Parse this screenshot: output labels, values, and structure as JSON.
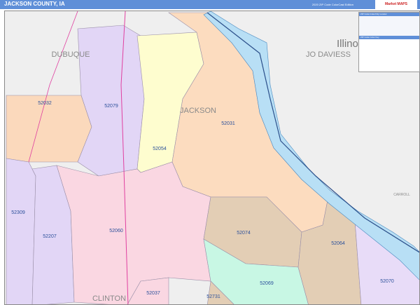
{
  "header": {
    "title": "JACKSON COUNTY, IA",
    "edition": "2020 ZIP Code ColorCast Edition",
    "logo": "Market MAPS"
  },
  "map": {
    "county_labels": [
      "DUBUQUE",
      "JACKSON",
      "CLINTON",
      "JO DAVIESS",
      "CARROLL"
    ],
    "state_label": "Illinois",
    "zips": [
      {
        "zip": "52032",
        "color": "#fbd9bc"
      },
      {
        "zip": "52079",
        "color": "#e2d6f6"
      },
      {
        "zip": "52054",
        "color": "#fefdcf"
      },
      {
        "zip": "52031",
        "color": "#fcdcbf"
      },
      {
        "zip": "52309",
        "color": "#e2d6f6"
      },
      {
        "zip": "52207",
        "color": "#e2d6f6"
      },
      {
        "zip": "52060",
        "color": "#fad7e2"
      },
      {
        "zip": "52074",
        "color": "#e3ceb5"
      },
      {
        "zip": "52069",
        "color": "#c8f7e4"
      },
      {
        "zip": "52064",
        "color": "#e3ceb5"
      },
      {
        "zip": "52070",
        "color": "#e8dcf8"
      },
      {
        "zip": "52037",
        "color": "#fad7e2"
      },
      {
        "zip": "52731",
        "color": "#e3ceb5"
      }
    ]
  },
  "legend": {
    "title": "ZIP Code Index/City Locator",
    "section2": "ZIP Code Color Key"
  }
}
